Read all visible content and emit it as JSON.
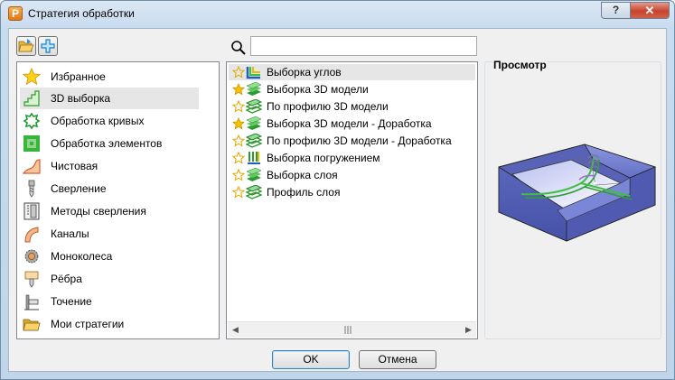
{
  "window": {
    "title": "Стратегия обработки",
    "app_icon_letter": "P",
    "help_label": "?",
    "close_label": "✕"
  },
  "toolbar": {
    "open_icon": "folder-open-icon",
    "add_icon": "add-icon"
  },
  "search": {
    "value": "",
    "placeholder": ""
  },
  "categories": [
    {
      "label": "Избранное",
      "icon": "star-icon"
    },
    {
      "label": "3D выборка",
      "icon": "3d-roughing-icon"
    },
    {
      "label": "Обработка кривых",
      "icon": "curve-machining-icon"
    },
    {
      "label": "Обработка элементов",
      "icon": "feature-machining-icon"
    },
    {
      "label": "Чистовая",
      "icon": "finishing-icon"
    },
    {
      "label": "Сверление",
      "icon": "drilling-icon"
    },
    {
      "label": "Методы сверления",
      "icon": "drilling-methods-icon"
    },
    {
      "label": "Каналы",
      "icon": "ports-icon"
    },
    {
      "label": "Моноколеса",
      "icon": "blisk-icon"
    },
    {
      "label": "Рёбра",
      "icon": "ribs-icon"
    },
    {
      "label": "Точение",
      "icon": "turning-icon"
    },
    {
      "label": "Мои стратегии",
      "icon": "folder-icon"
    }
  ],
  "selected_category": "3D выборка",
  "strategies": [
    {
      "label": "Выборка углов",
      "favorite": false,
      "icon": "corner-clearance-icon"
    },
    {
      "label": "Выборка 3D модели",
      "favorite": true,
      "icon": "model-area-clearance-icon"
    },
    {
      "label": "По профилю 3D модели",
      "favorite": false,
      "icon": "model-profile-icon"
    },
    {
      "label": "Выборка 3D модели - Доработка",
      "favorite": true,
      "icon": "model-rest-area-clearance-icon"
    },
    {
      "label": "По профилю 3D модели - Доработка",
      "favorite": false,
      "icon": "model-rest-profile-icon"
    },
    {
      "label": "Выборка погружением",
      "favorite": false,
      "icon": "plunge-milling-icon"
    },
    {
      "label": "Выборка слоя",
      "favorite": false,
      "icon": "slice-area-clearance-icon"
    },
    {
      "label": "Профиль слоя",
      "favorite": false,
      "icon": "slice-profile-icon"
    }
  ],
  "selected_strategy": "Выборка углов",
  "preview": {
    "title": "Просмотр"
  },
  "buttons": {
    "ok": "OK",
    "cancel": "Отмена"
  },
  "colors": {
    "selection": "#e6e6e6",
    "model_face": "#6b78c8",
    "toolpath": "#3fbf3f",
    "star": "#f5c400"
  }
}
